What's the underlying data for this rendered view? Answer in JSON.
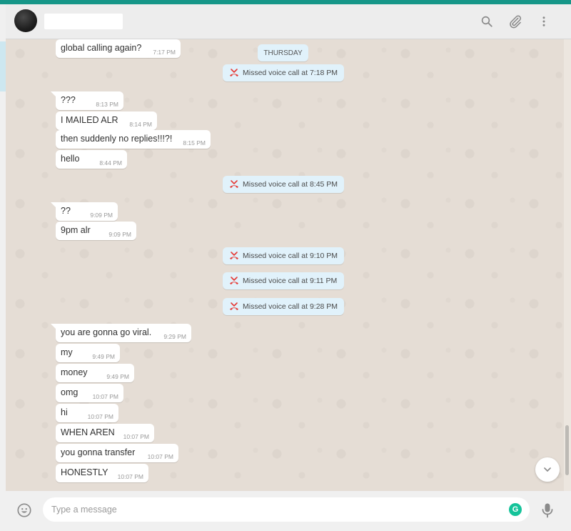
{
  "header": {
    "contact_name": "",
    "icons": [
      "search-icon",
      "paperclip-icon",
      "menu-dots-icon"
    ]
  },
  "chat": {
    "date_divider": "THURSDAY",
    "messages": [
      {
        "text": "global calling again?",
        "time": "7:17 PM"
      },
      {
        "text": "???",
        "time": "8:13 PM"
      },
      {
        "text": "I MAILED ALR",
        "time": "8:14 PM"
      },
      {
        "text": "then suddenly no replies!!!?!",
        "time": "8:15 PM"
      },
      {
        "text": "hello",
        "time": "8:44 PM"
      },
      {
        "text": "??",
        "time": "9:09 PM"
      },
      {
        "text": "9pm alr",
        "time": "9:09 PM"
      },
      {
        "text": "you are gonna go viral.",
        "time": "9:29 PM"
      },
      {
        "text": "my",
        "time": "9:49 PM"
      },
      {
        "text": "money",
        "time": "9:49 PM"
      },
      {
        "text": "omg",
        "time": "10:07 PM"
      },
      {
        "text": "hi",
        "time": "10:07 PM"
      },
      {
        "text": "WHEN AREN",
        "time": "10:07 PM"
      },
      {
        "text": "you gonna transfer",
        "time": "10:07 PM"
      },
      {
        "text": "HONESTLY",
        "time": "10:07 PM"
      }
    ],
    "missed_calls": [
      "Missed voice call at 7:18 PM",
      "Missed voice call at 8:45 PM",
      "Missed voice call at 9:10 PM",
      "Missed voice call at 9:11 PM",
      "Missed voice call at 9:28 PM"
    ]
  },
  "composer": {
    "placeholder": "Type a message",
    "value": "",
    "grammarly_label": "G"
  },
  "colors": {
    "accent": "#169688",
    "bubble": "#ffffff",
    "system_bubble": "#e1f2fb",
    "missed_call_icon": "#e53935",
    "chat_bg": "#e5ddd5"
  }
}
